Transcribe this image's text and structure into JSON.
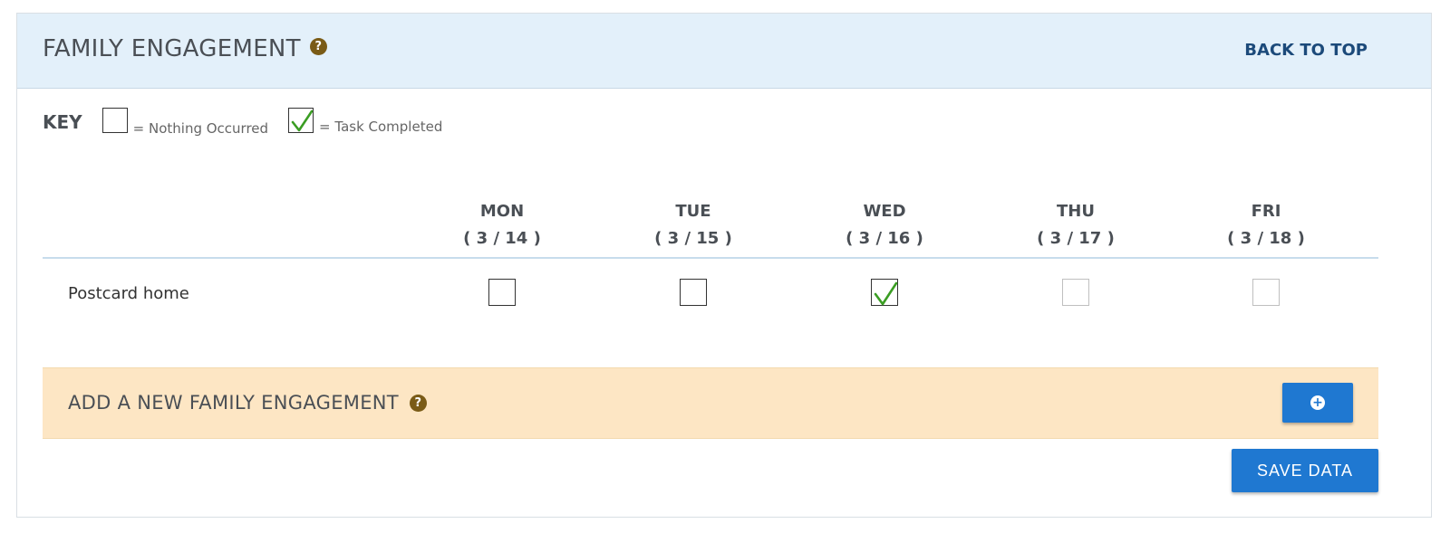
{
  "header": {
    "title": "FAMILY ENGAGEMENT",
    "help_icon": "question-circle-icon",
    "back_to_top": "BACK TO TOP"
  },
  "key": {
    "label": "KEY",
    "nothing_occurred": "= Nothing Occurred",
    "task_completed": "= Task Completed"
  },
  "days": [
    {
      "day": "MON",
      "date": "( 3 / 14 )"
    },
    {
      "day": "TUE",
      "date": "( 3 / 15 )"
    },
    {
      "day": "WED",
      "date": "( 3 / 16 )"
    },
    {
      "day": "THU",
      "date": "( 3 / 17 )"
    },
    {
      "day": "FRI",
      "date": "( 3 / 18 )"
    }
  ],
  "rows": [
    {
      "task": "Postcard home",
      "cells": [
        {
          "checked": false,
          "enabled": true
        },
        {
          "checked": false,
          "enabled": true
        },
        {
          "checked": true,
          "enabled": true
        },
        {
          "checked": false,
          "enabled": false
        },
        {
          "checked": false,
          "enabled": false
        }
      ]
    }
  ],
  "add_section": {
    "title": "ADD A NEW FAMILY ENGAGEMENT",
    "add_icon": "plus-circle-icon"
  },
  "save_label": "SAVE DATA",
  "colors": {
    "header_bg": "#e3f0fa",
    "add_bar_bg": "#fde6c4",
    "button_blue": "#1f78d1",
    "check_green": "#3a9d23",
    "help_icon_brown": "#7a5b16"
  }
}
